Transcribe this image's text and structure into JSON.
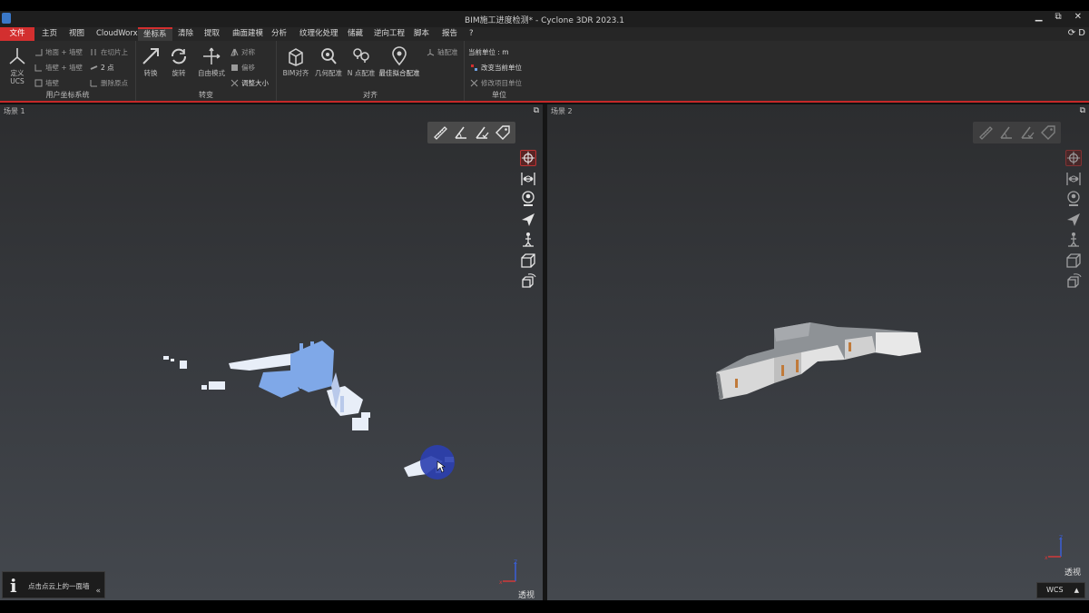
{
  "window": {
    "title": "BIM施工进度检测* - Cyclone 3DR 2023.1",
    "controls": [
      "▁",
      "⧉",
      "✕"
    ]
  },
  "menu": {
    "items": [
      "文件",
      "主页",
      "视图",
      "CloudWorx",
      "坐标系",
      "清除",
      "提取",
      "曲面建模",
      "分析",
      "纹理化处理",
      "储藏",
      "逆向工程",
      "脚本",
      "报告",
      "?"
    ],
    "active_index": 4,
    "right_label": "D"
  },
  "ribbon": {
    "ucs_group": {
      "label": "用户坐标系统",
      "define_btn": "定义\nUCS",
      "floor_wall": "地面 + 墙壁",
      "wall_wall": "墙壁 + 墙壁",
      "wall": "墙壁",
      "on_slice": "在切片上",
      "two_points": "2 点",
      "remove_origin": "删除原点"
    },
    "transform_group": {
      "label": "转变",
      "convert": "转换",
      "rotate": "旋转",
      "free_mode": "自由模式",
      "symmetry": "对称",
      "offset": "偏移",
      "resize": "调整大小"
    },
    "align_group": {
      "label": "对齐",
      "bim_align": "BIM对齐",
      "geo_register": "几何配准",
      "n_point": "N 点配准",
      "best_fit": "最佳拟合配准",
      "axis_register": "轴配准"
    },
    "unit_group": {
      "label": "单位",
      "current_unit": "当前单位 : m",
      "change_unit": "改变当前单位",
      "modify_project_unit": "修改项目单位"
    }
  },
  "scene1": {
    "title": "场景 1",
    "view_mode": "透视",
    "hint": "点击点云上的一面墙",
    "collapse": "«"
  },
  "scene2": {
    "title": "场景 2",
    "view_mode": "透视",
    "coord_system": "WCS"
  },
  "colors": {
    "accent": "#d32f2f",
    "ribbon_bg": "#2b2b2b",
    "viewport_top": "#2c2d2f",
    "viewport_bottom": "#44484e"
  }
}
